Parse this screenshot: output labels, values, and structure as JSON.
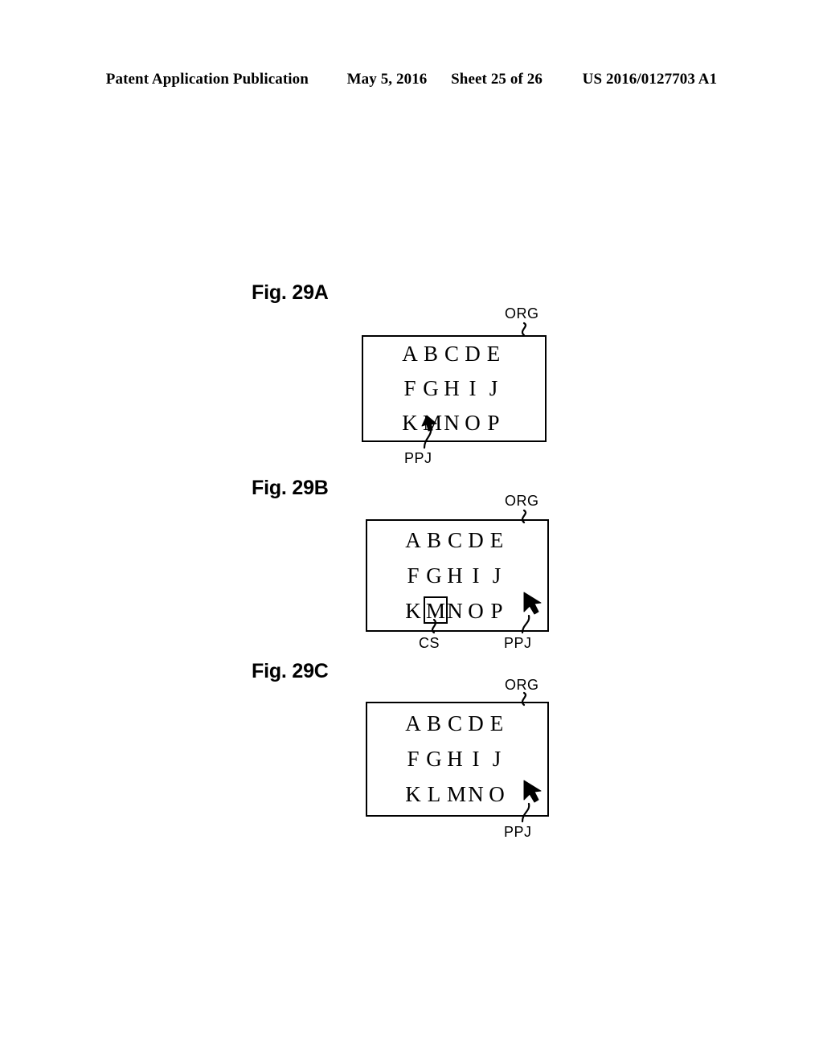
{
  "header": {
    "publication": "Patent Application Publication",
    "date": "May 5, 2016",
    "sheet": "Sheet 25 of 26",
    "doc_number": "US 2016/0127703 A1"
  },
  "figures": [
    {
      "label": "Fig. 29A",
      "frame_ref": "ORG",
      "pointer_ref": "PPJ",
      "rows": [
        [
          "A",
          "B",
          "C",
          "D",
          "E"
        ],
        [
          "F",
          "G",
          "H",
          "I",
          "J"
        ],
        [
          "K",
          "M",
          "N",
          "O",
          "P"
        ]
      ],
      "selected_row": -1,
      "selected_index": -1,
      "cursor_ref": ""
    },
    {
      "label": "Fig. 29B",
      "frame_ref": "ORG",
      "pointer_ref": "PPJ",
      "rows": [
        [
          "A",
          "B",
          "C",
          "D",
          "E"
        ],
        [
          "F",
          "G",
          "H",
          "I",
          "J"
        ],
        [
          "K",
          "M",
          "N",
          "O",
          "P"
        ]
      ],
      "selected_row": 2,
      "selected_index": 1,
      "cursor_ref": "CS"
    },
    {
      "label": "Fig. 29C",
      "frame_ref": "ORG",
      "pointer_ref": "PPJ",
      "rows": [
        [
          "A",
          "B",
          "C",
          "D",
          "E"
        ],
        [
          "F",
          "G",
          "H",
          "I",
          "J"
        ],
        [
          "K",
          "L",
          "M",
          "N",
          "O"
        ]
      ],
      "selected_row": -1,
      "selected_index": -1,
      "cursor_ref": ""
    }
  ]
}
